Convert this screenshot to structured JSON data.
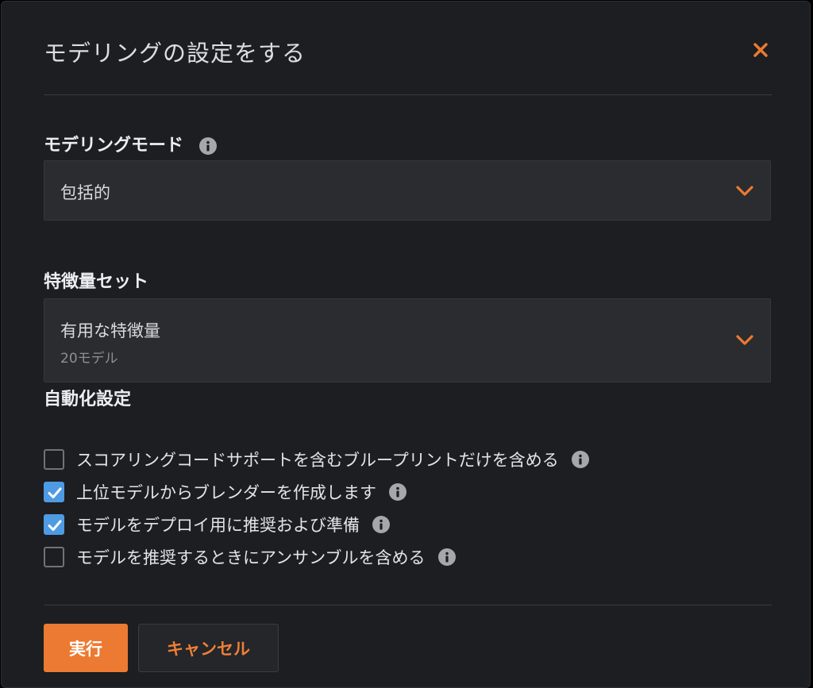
{
  "dialog": {
    "title": "モデリングの設定をする",
    "close_icon": "close-icon",
    "accent_color": "#ec7a32",
    "check_color": "#4f9be3"
  },
  "modeling_mode": {
    "label": "モデリングモード",
    "info_icon": "info-icon",
    "selected": "包括的"
  },
  "feature_set": {
    "label": "特徴量セット",
    "selected": "有用な特徴量",
    "subtext": "20モデル"
  },
  "automation": {
    "label": "自動化設定",
    "options": [
      {
        "label": "スコアリングコードサポートを含むブループリントだけを含める",
        "checked": false
      },
      {
        "label": "上位モデルからブレンダーを作成します",
        "checked": true
      },
      {
        "label": "モデルをデプロイ用に推奨および準備",
        "checked": true
      },
      {
        "label": "モデルを推奨するときにアンサンブルを含める",
        "checked": false
      }
    ]
  },
  "footer": {
    "run_label": "実行",
    "cancel_label": "キャンセル"
  }
}
